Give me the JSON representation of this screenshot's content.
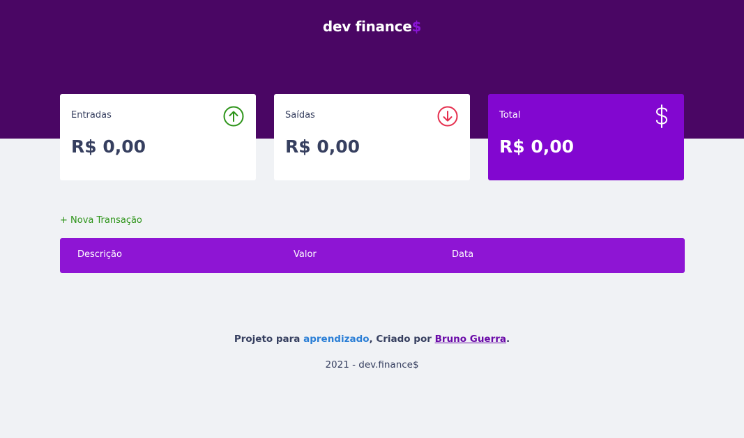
{
  "header": {
    "logo_text": "dev finance",
    "logo_dollar": "$",
    "background": "#4a0664"
  },
  "cards": {
    "entradas": {
      "label": "Entradas",
      "value": "R$ 0,00",
      "icon": "arrow-up-circle-icon",
      "icon_color": "#2d9419"
    },
    "saidas": {
      "label": "Saídas",
      "value": "R$ 0,00",
      "icon": "arrow-down-circle-icon",
      "icon_color": "#e52e4d"
    },
    "total": {
      "label": "Total",
      "value": "R$ 0,00",
      "icon": "dollar-icon",
      "background": "#8207d0"
    }
  },
  "actions": {
    "new_transaction": "+ Nova Transação"
  },
  "table": {
    "columns": [
      "Descrição",
      "Valor",
      "Data"
    ],
    "header_background": "#8e15d4"
  },
  "footer": {
    "prefix": "Projeto para ",
    "highlight": "aprendizado",
    "middle": ", Criado por ",
    "author": "Bruno Guerra",
    "suffix": ".",
    "copyright": "2021 - dev.finance$"
  }
}
